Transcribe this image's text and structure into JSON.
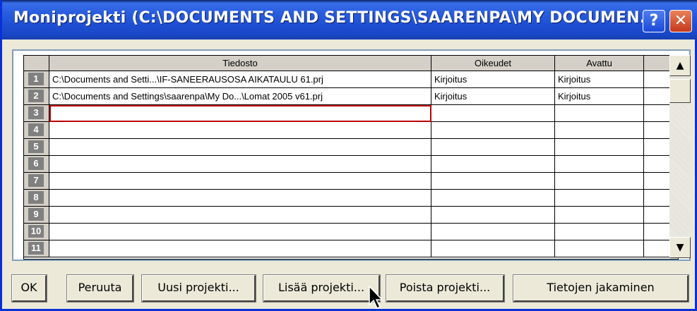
{
  "window": {
    "title": "Moniprojekti (C:\\DOCUMENTS AND SETTINGS\\SAARENPA\\MY DOCUMEN..."
  },
  "titlebar": {
    "help_label": "?",
    "close_label": "✕"
  },
  "grid": {
    "columns": [
      "Tiedosto",
      "Oikeudet",
      "Avattu"
    ],
    "rows": [
      {
        "num": "1",
        "file": "C:\\Documents and Setti...\\IF-SANEERAUSOSA AIKATAULU 61.prj",
        "rights": "Kirjoitus",
        "opened": "Kirjoitus"
      },
      {
        "num": "2",
        "file": "C:\\Documents and Settings\\saarenpa\\My Do...\\Lomat 2005 v61.prj",
        "rights": "Kirjoitus",
        "opened": "Kirjoitus"
      },
      {
        "num": "3",
        "file": "",
        "rights": "",
        "opened": ""
      },
      {
        "num": "4",
        "file": "",
        "rights": "",
        "opened": ""
      },
      {
        "num": "5",
        "file": "",
        "rights": "",
        "opened": ""
      },
      {
        "num": "6",
        "file": "",
        "rights": "",
        "opened": ""
      },
      {
        "num": "7",
        "file": "",
        "rights": "",
        "opened": ""
      },
      {
        "num": "8",
        "file": "",
        "rights": "",
        "opened": ""
      },
      {
        "num": "9",
        "file": "",
        "rights": "",
        "opened": ""
      },
      {
        "num": "10",
        "file": "",
        "rights": "",
        "opened": ""
      },
      {
        "num": "11",
        "file": "",
        "rights": "",
        "opened": ""
      }
    ]
  },
  "scrollbar": {
    "up_icon": "▲",
    "down_icon": "▼"
  },
  "buttons": {
    "ok": "OK",
    "cancel": "Peruuta",
    "new_project": "Uusi projekti...",
    "add_project": "Lisää projekti...",
    "remove_project": "Poista projekti...",
    "share_data": "Tietojen jakaminen"
  },
  "colors": {
    "titlebar": "#2a5fe0",
    "close": "#c4391c",
    "selected_cell_border": "#c00000"
  }
}
